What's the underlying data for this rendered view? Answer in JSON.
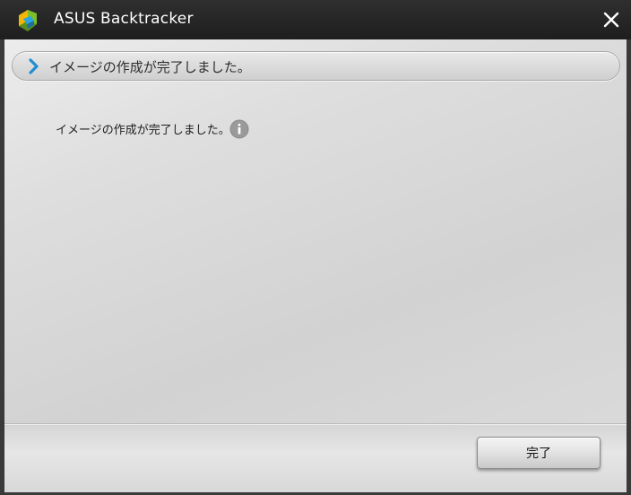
{
  "window": {
    "title": "ASUS Backtracker",
    "logo_icon": "asus-backtracker-logo-icon",
    "close_icon": "close-icon"
  },
  "step_bar": {
    "chevron_icon": "chevron-right-icon",
    "text": "イメージの作成が完了しました。"
  },
  "content": {
    "message": "イメージの作成が完了しました。",
    "info_icon": "info-icon"
  },
  "footer": {
    "done_label": "完了"
  },
  "colors": {
    "titlebar": "#262626",
    "accent_blue": "#2aa6e0",
    "logo_yellow": "#f2b705",
    "logo_green": "#7cbf2a"
  }
}
